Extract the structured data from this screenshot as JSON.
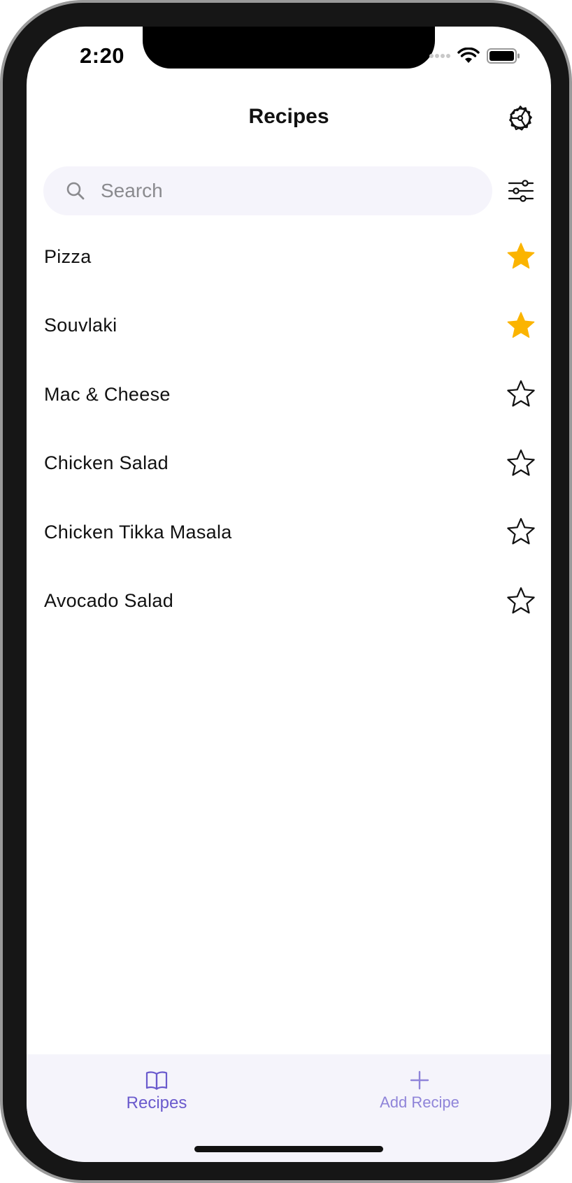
{
  "status_bar": {
    "time": "2:20",
    "icons": [
      "signal-dots-icon",
      "wifi-icon",
      "battery-icon"
    ]
  },
  "nav": {
    "title": "Recipes",
    "right_icon": "settings-gear-icon"
  },
  "search": {
    "placeholder": "Search",
    "value": "",
    "filter_icon": "sliders-icon"
  },
  "recipes": [
    {
      "name": "Pizza",
      "favorite": true
    },
    {
      "name": "Souvlaki",
      "favorite": true
    },
    {
      "name": "Mac & Cheese",
      "favorite": false
    },
    {
      "name": "Chicken Salad",
      "favorite": false
    },
    {
      "name": "Chicken Tikka Masala",
      "favorite": false
    },
    {
      "name": "Avocado Salad",
      "favorite": false
    }
  ],
  "tabs": [
    {
      "label": "Recipes",
      "icon": "book-icon",
      "selected": true
    },
    {
      "label": "Add Recipe",
      "icon": "plus-icon",
      "selected": false
    }
  ],
  "colors": {
    "accent": "#6a5acd",
    "accent_muted": "#8f84d9",
    "favorite_star": "#fbb400",
    "search_bg": "#f5f4fb",
    "tab_bar_bg": "#f5f4fb"
  }
}
